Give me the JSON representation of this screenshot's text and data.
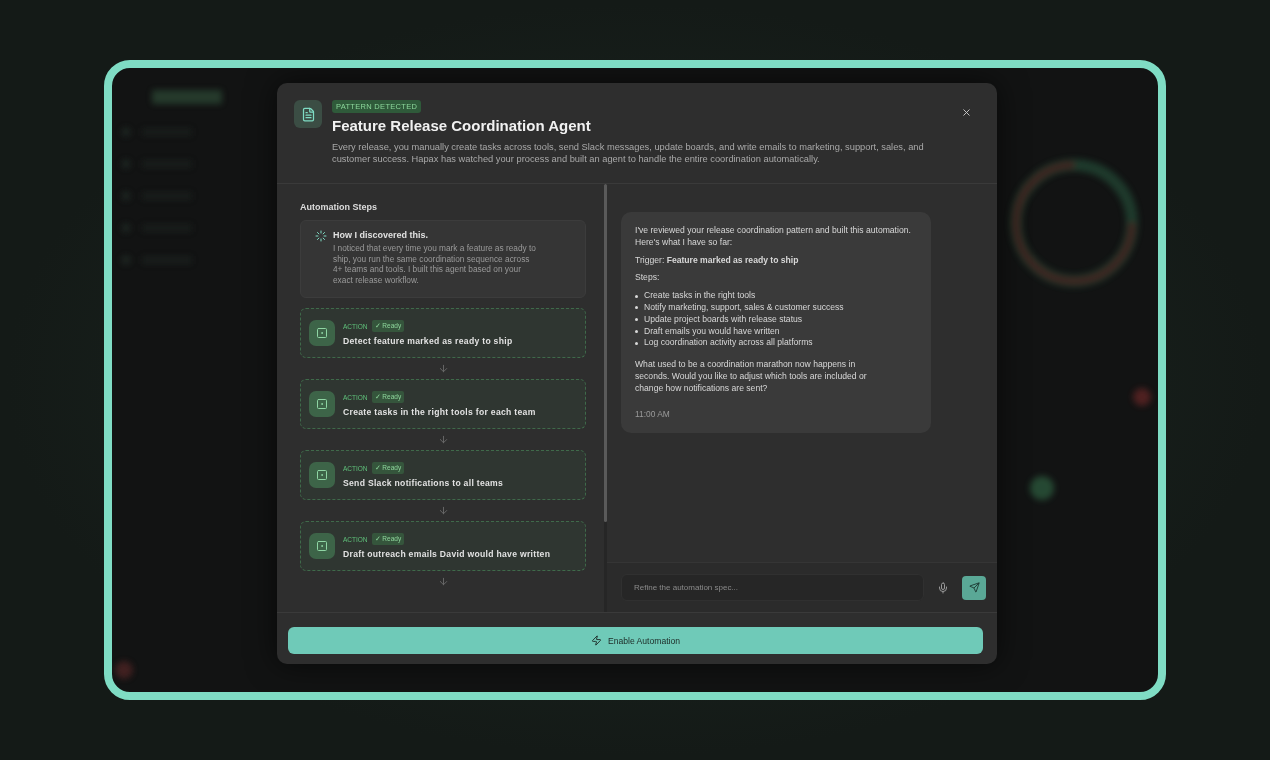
{
  "modal": {
    "badge": "PATTERN DETECTED",
    "title": "Feature Release Coordination Agent",
    "description": "Every release, you manually create tasks across tools, send Slack messages, update boards, and write emails to marketing, support, sales, and customer success. Hapax has watched your process and built an agent to handle the entire coordination automatically."
  },
  "steps_panel": {
    "heading": "Automation Steps",
    "discovery": {
      "title": "How I discovered this.",
      "text": "I noticed that every time you mark a feature as ready to ship, you run the same coordination sequence across 4+ teams and tools. I built this agent based on your exact release workflow."
    },
    "steps": [
      {
        "label": "ACTION",
        "status": "✓ Ready",
        "title": "Detect feature marked as ready to ship"
      },
      {
        "label": "ACTION",
        "status": "✓ Ready",
        "title": "Create tasks in the right tools for each team"
      },
      {
        "label": "ACTION",
        "status": "✓ Ready",
        "title": "Send Slack notifications to all teams"
      },
      {
        "label": "ACTION",
        "status": "✓ Ready",
        "title": "Draft outreach emails David would have written"
      }
    ]
  },
  "chat": {
    "message": {
      "intro": "I've reviewed your release coordination pattern and built this automation. Here's what I have so far:",
      "trigger": "Trigger: **Feature marked as ready to ship**",
      "steps_label": "Steps:",
      "bullets": [
        "Create tasks in the right tools",
        "Notify marketing, support, sales & customer success",
        "Update project boards with release status",
        "Draft emails you would have written",
        "Log coordination activity across all platforms"
      ],
      "closing": "What used to be a coordination marathon now happens in seconds. Would you like to adjust which tools are included or change how notifications are sent?",
      "time": "11:00 AM"
    },
    "input": {
      "placeholder": "Refine the automation spec..."
    }
  },
  "footer": {
    "button": "Enable Automation"
  }
}
